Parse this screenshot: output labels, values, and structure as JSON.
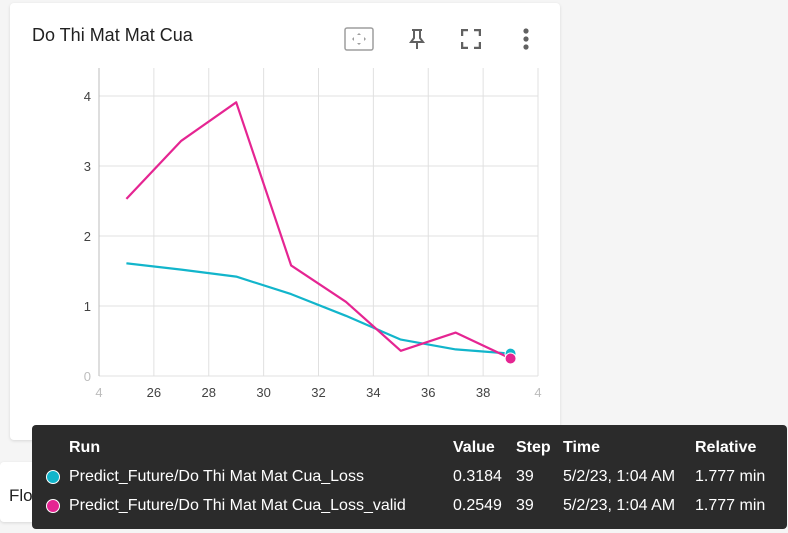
{
  "card": {
    "title": "Do Thi Mat Mat Cua",
    "toolbar": [
      {
        "name": "fit-domain-icon"
      },
      {
        "name": "pin-icon"
      },
      {
        "name": "fullscreen-icon"
      },
      {
        "name": "more-vert-icon"
      }
    ]
  },
  "chart_data": {
    "type": "line",
    "x_ticks": [
      "4",
      "26",
      "28",
      "30",
      "32",
      "34",
      "36",
      "38",
      "4"
    ],
    "y_ticks": [
      "0",
      "1",
      "2",
      "3",
      "4"
    ],
    "xlim": [
      24,
      40
    ],
    "ylim": [
      0,
      4.4
    ],
    "grid": true,
    "series": [
      {
        "name": "Predict_Future/Do Thi Mat Mat Cua_Loss",
        "color": "#12b5cb",
        "x": [
          25,
          27,
          29,
          31,
          33,
          35,
          37,
          39
        ],
        "y": [
          1.61,
          1.52,
          1.42,
          1.17,
          0.86,
          0.52,
          0.38,
          0.32
        ]
      },
      {
        "name": "Predict_Future/Do Thi Mat Mat Cua_Loss_valid",
        "color": "#e52592",
        "x": [
          25,
          27,
          29,
          31,
          33,
          35,
          37,
          39
        ],
        "y": [
          2.53,
          3.36,
          3.91,
          1.58,
          1.06,
          0.36,
          0.62,
          0.25
        ]
      }
    ]
  },
  "flower": {
    "label": "Flower"
  },
  "tooltip": {
    "headers": {
      "run": "Run",
      "value": "Value",
      "step": "Step",
      "time": "Time",
      "relative": "Relative"
    },
    "rows": [
      {
        "color": "#12b5cb",
        "run": "Predict_Future/Do Thi Mat Mat Cua_Loss",
        "value": "0.3184",
        "step": "39",
        "time": "5/2/23, 1:04 AM",
        "relative": "1.777 min"
      },
      {
        "color": "#e52592",
        "run": "Predict_Future/Do Thi Mat Mat Cua_Loss_valid",
        "value": "0.2549",
        "step": "39",
        "time": "5/2/23, 1:04 AM",
        "relative": "1.777 min"
      }
    ]
  }
}
